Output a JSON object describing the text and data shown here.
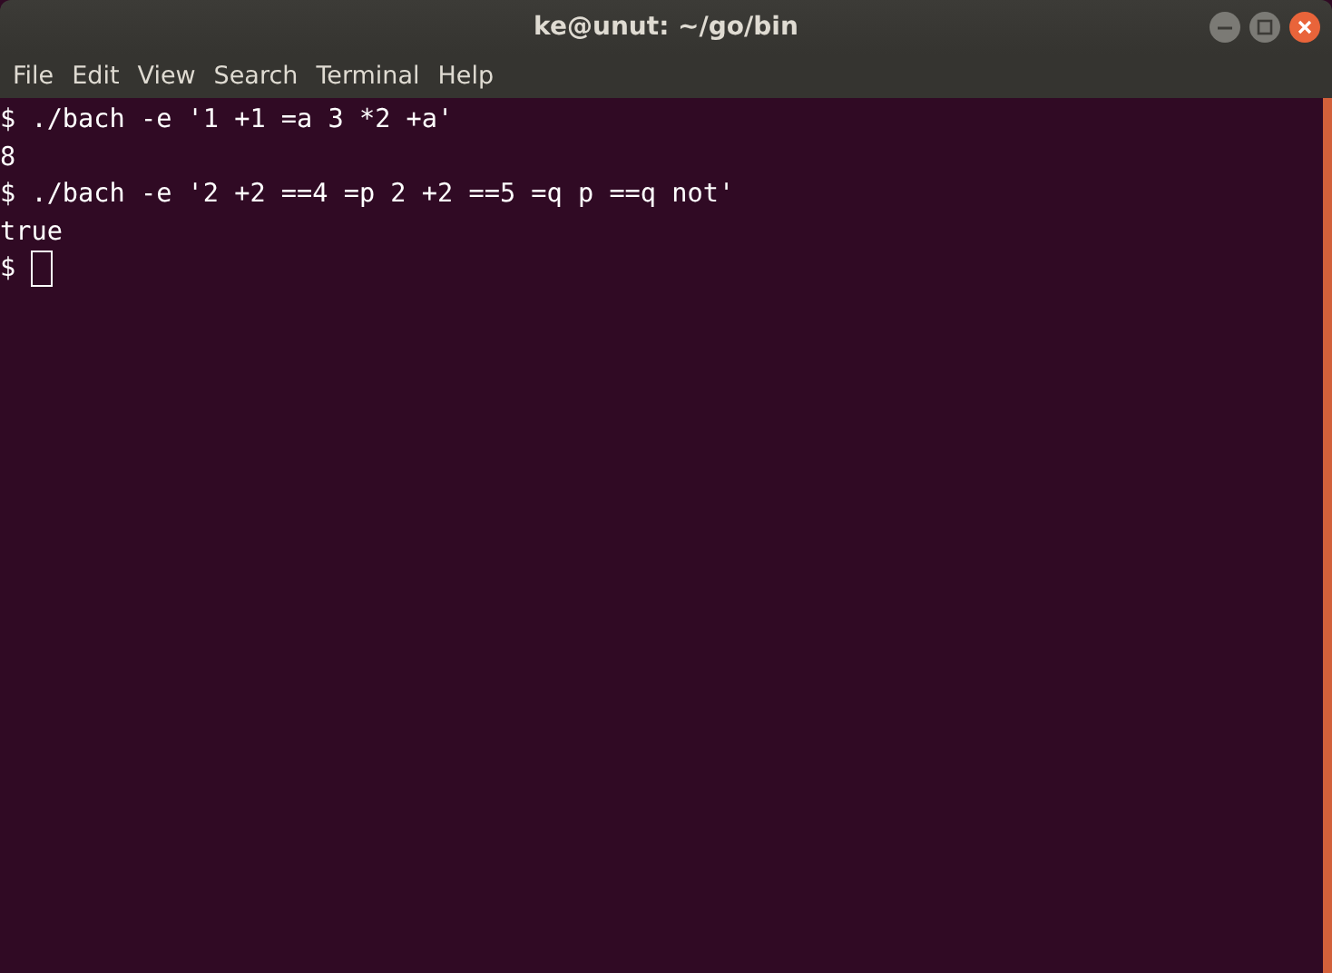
{
  "window": {
    "title": "ke@unut: ~/go/bin"
  },
  "menu": [
    "File",
    "Edit",
    "View",
    "Search",
    "Terminal",
    "Help"
  ],
  "lines": [
    {
      "text": "$ ./bach -e '1 +1 =a 3 *2 +a'",
      "cursor": false
    },
    {
      "text": "8",
      "cursor": false
    },
    {
      "text": "$ ./bach -e '2 +2 ==4 =p 2 +2 ==5 =q p ==q not'",
      "cursor": false
    },
    {
      "text": "true",
      "cursor": false
    },
    {
      "text": "$",
      "cursor": true
    }
  ]
}
